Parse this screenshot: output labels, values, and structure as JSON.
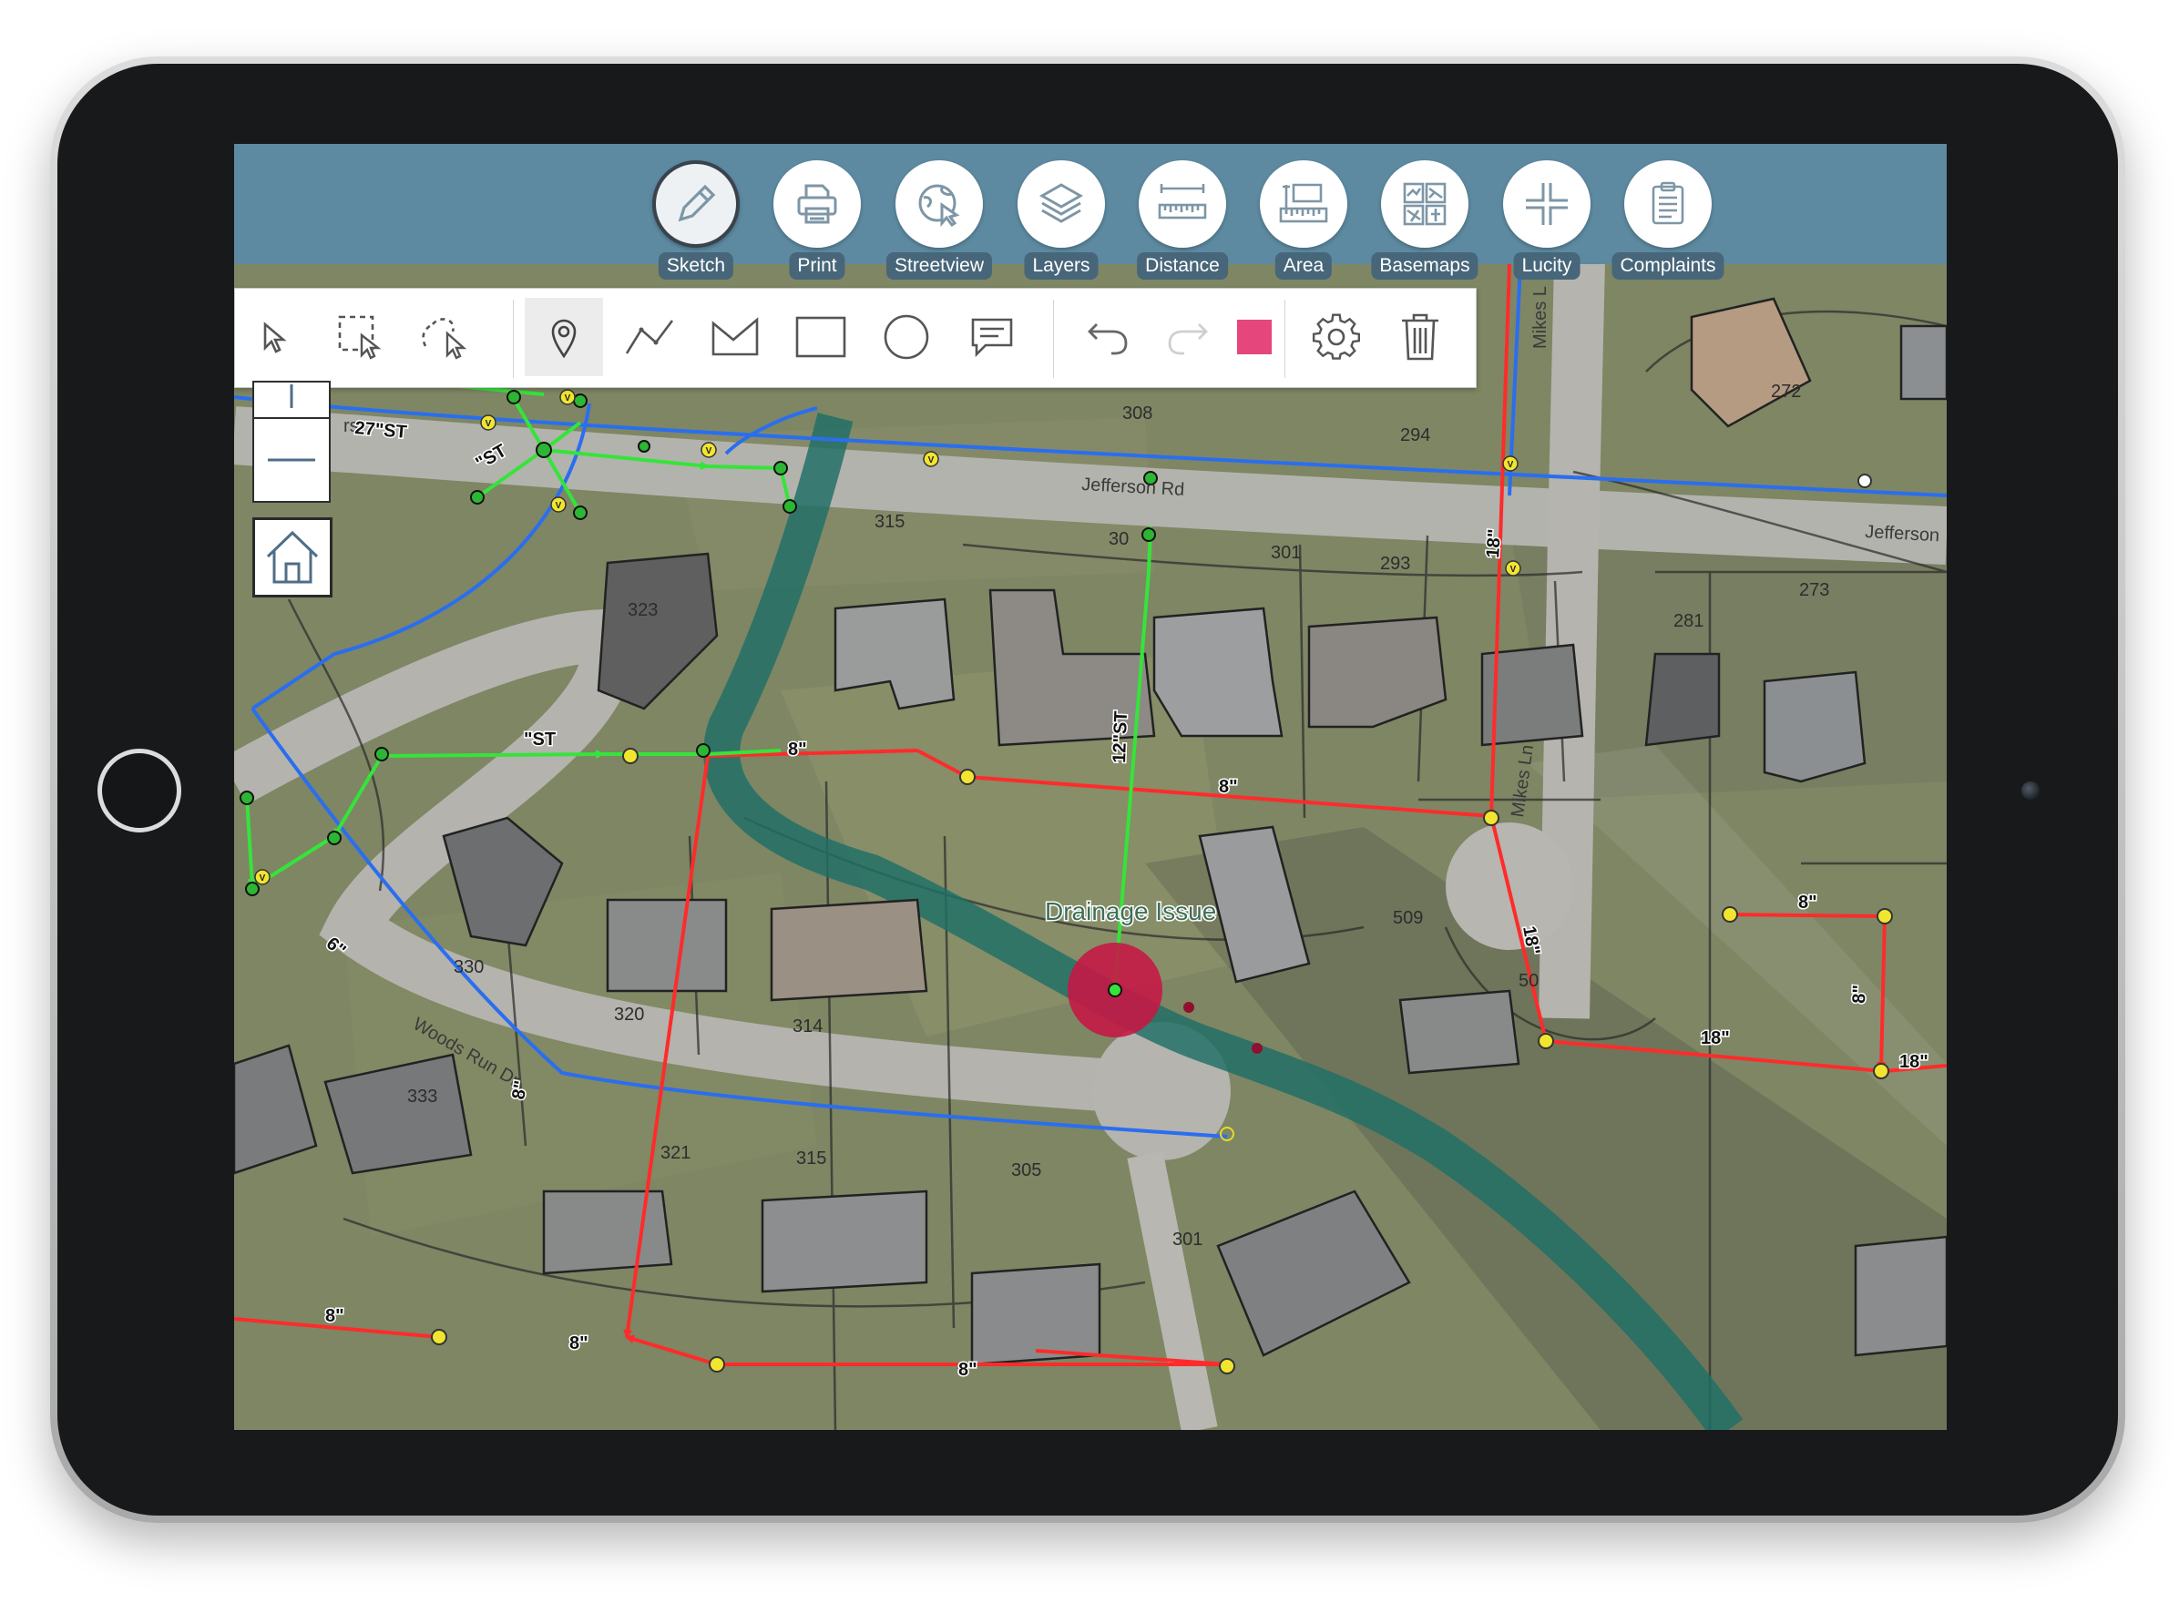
{
  "toolbar": {
    "tools": [
      {
        "label": "Sketch",
        "icon": "pencil-icon"
      },
      {
        "label": "Print",
        "icon": "printer-icon"
      },
      {
        "label": "Streetview",
        "icon": "streetview-icon"
      },
      {
        "label": "Layers",
        "icon": "layers-icon"
      },
      {
        "label": "Distance",
        "icon": "ruler-icon"
      },
      {
        "label": "Area",
        "icon": "area-icon"
      },
      {
        "label": "Basemaps",
        "icon": "basemaps-icon"
      },
      {
        "label": "Lucity",
        "icon": "lucity-icon"
      },
      {
        "label": "Complaints",
        "icon": "clipboard-icon"
      }
    ],
    "active": "Sketch"
  },
  "sketch_tools": [
    "select-icon",
    "box-select-icon",
    "lasso-select-icon",
    "point-icon",
    "polyline-icon",
    "polygon-icon",
    "rectangle-icon",
    "circle-icon",
    "text-comment-icon",
    "undo-icon",
    "redo-icon",
    "color-swatch",
    "settings-icon",
    "trash-icon"
  ],
  "sketch_color": "#e5467b",
  "map": {
    "annotation": "Drainage Issue",
    "streets": {
      "jefferson_rd": "Jefferson Rd",
      "jefferson_edge": "Jefferson",
      "woods_run": "Woods Run Dr",
      "mikes_ln": "Mikes Ln",
      "mikes_top": "Mikes L",
      "rs_fragment": "rs"
    },
    "parcels": {
      "p308": "308",
      "p294": "294",
      "p272": "272",
      "p315a": "315",
      "p30x": "30",
      "p301a": "301",
      "p293": "293",
      "p273": "273",
      "p323": "323",
      "p281": "281",
      "p330": "330",
      "p320": "320",
      "p314": "314",
      "p509": "509",
      "p50x": "50",
      "p333": "333",
      "p321": "321",
      "p315b": "315",
      "p305": "305",
      "p301b": "301"
    },
    "pipes": {
      "st27": "27\"ST",
      "st_a": "\"ST",
      "st_b": "\"ST",
      "st12": "12\"ST",
      "e8a": "8\"",
      "e8b": "8\"",
      "e8c": "8\"",
      "e8d": "8\"",
      "e8e": "8\"",
      "e8f": "8\"",
      "e8g": "8\"",
      "e8h": "8\"",
      "e8i": "8\"",
      "e18a": "18\"",
      "e18b": "18\"",
      "e18c": "18\"",
      "e18d": "18\"",
      "w6": "6\""
    },
    "valve_letter": "V",
    "colors": {
      "sanitary": "#ff2b2b",
      "storm": "#35e43a",
      "water": "#2a6ef0",
      "creek": "#1f6f66",
      "issue": "#c71644"
    }
  }
}
